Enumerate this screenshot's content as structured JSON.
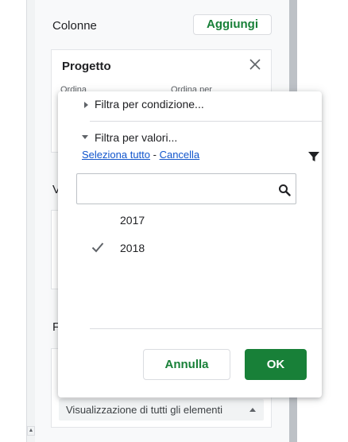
{
  "panel": {
    "columns_title": "Colonne",
    "add_label": "Aggiungi",
    "card": {
      "title": "Progetto",
      "sort_label": "Ordina",
      "sort_by_label": "Ordina per"
    },
    "values_title_partial": "V",
    "filters_title_partial": "F",
    "bottom_select_value": "Visualizzazione di tutti gli elementi"
  },
  "filter_menu": {
    "condition_label": "Filtra per condizione...",
    "values_label": "Filtra per valori...",
    "select_all": "Seleziona tutto",
    "separator": " - ",
    "clear": "Cancella",
    "search_value": "",
    "items": [
      {
        "label": "2017",
        "checked": false
      },
      {
        "label": "2018",
        "checked": true
      }
    ],
    "cancel_label": "Annulla",
    "ok_label": "OK"
  },
  "colors": {
    "accent_green": "#188038",
    "link_blue": "#1155cc"
  },
  "icons": [
    "close-icon",
    "funnel-icon",
    "search-icon",
    "check-icon",
    "triangle-right-icon",
    "triangle-down-icon",
    "caret-up-icon"
  ]
}
